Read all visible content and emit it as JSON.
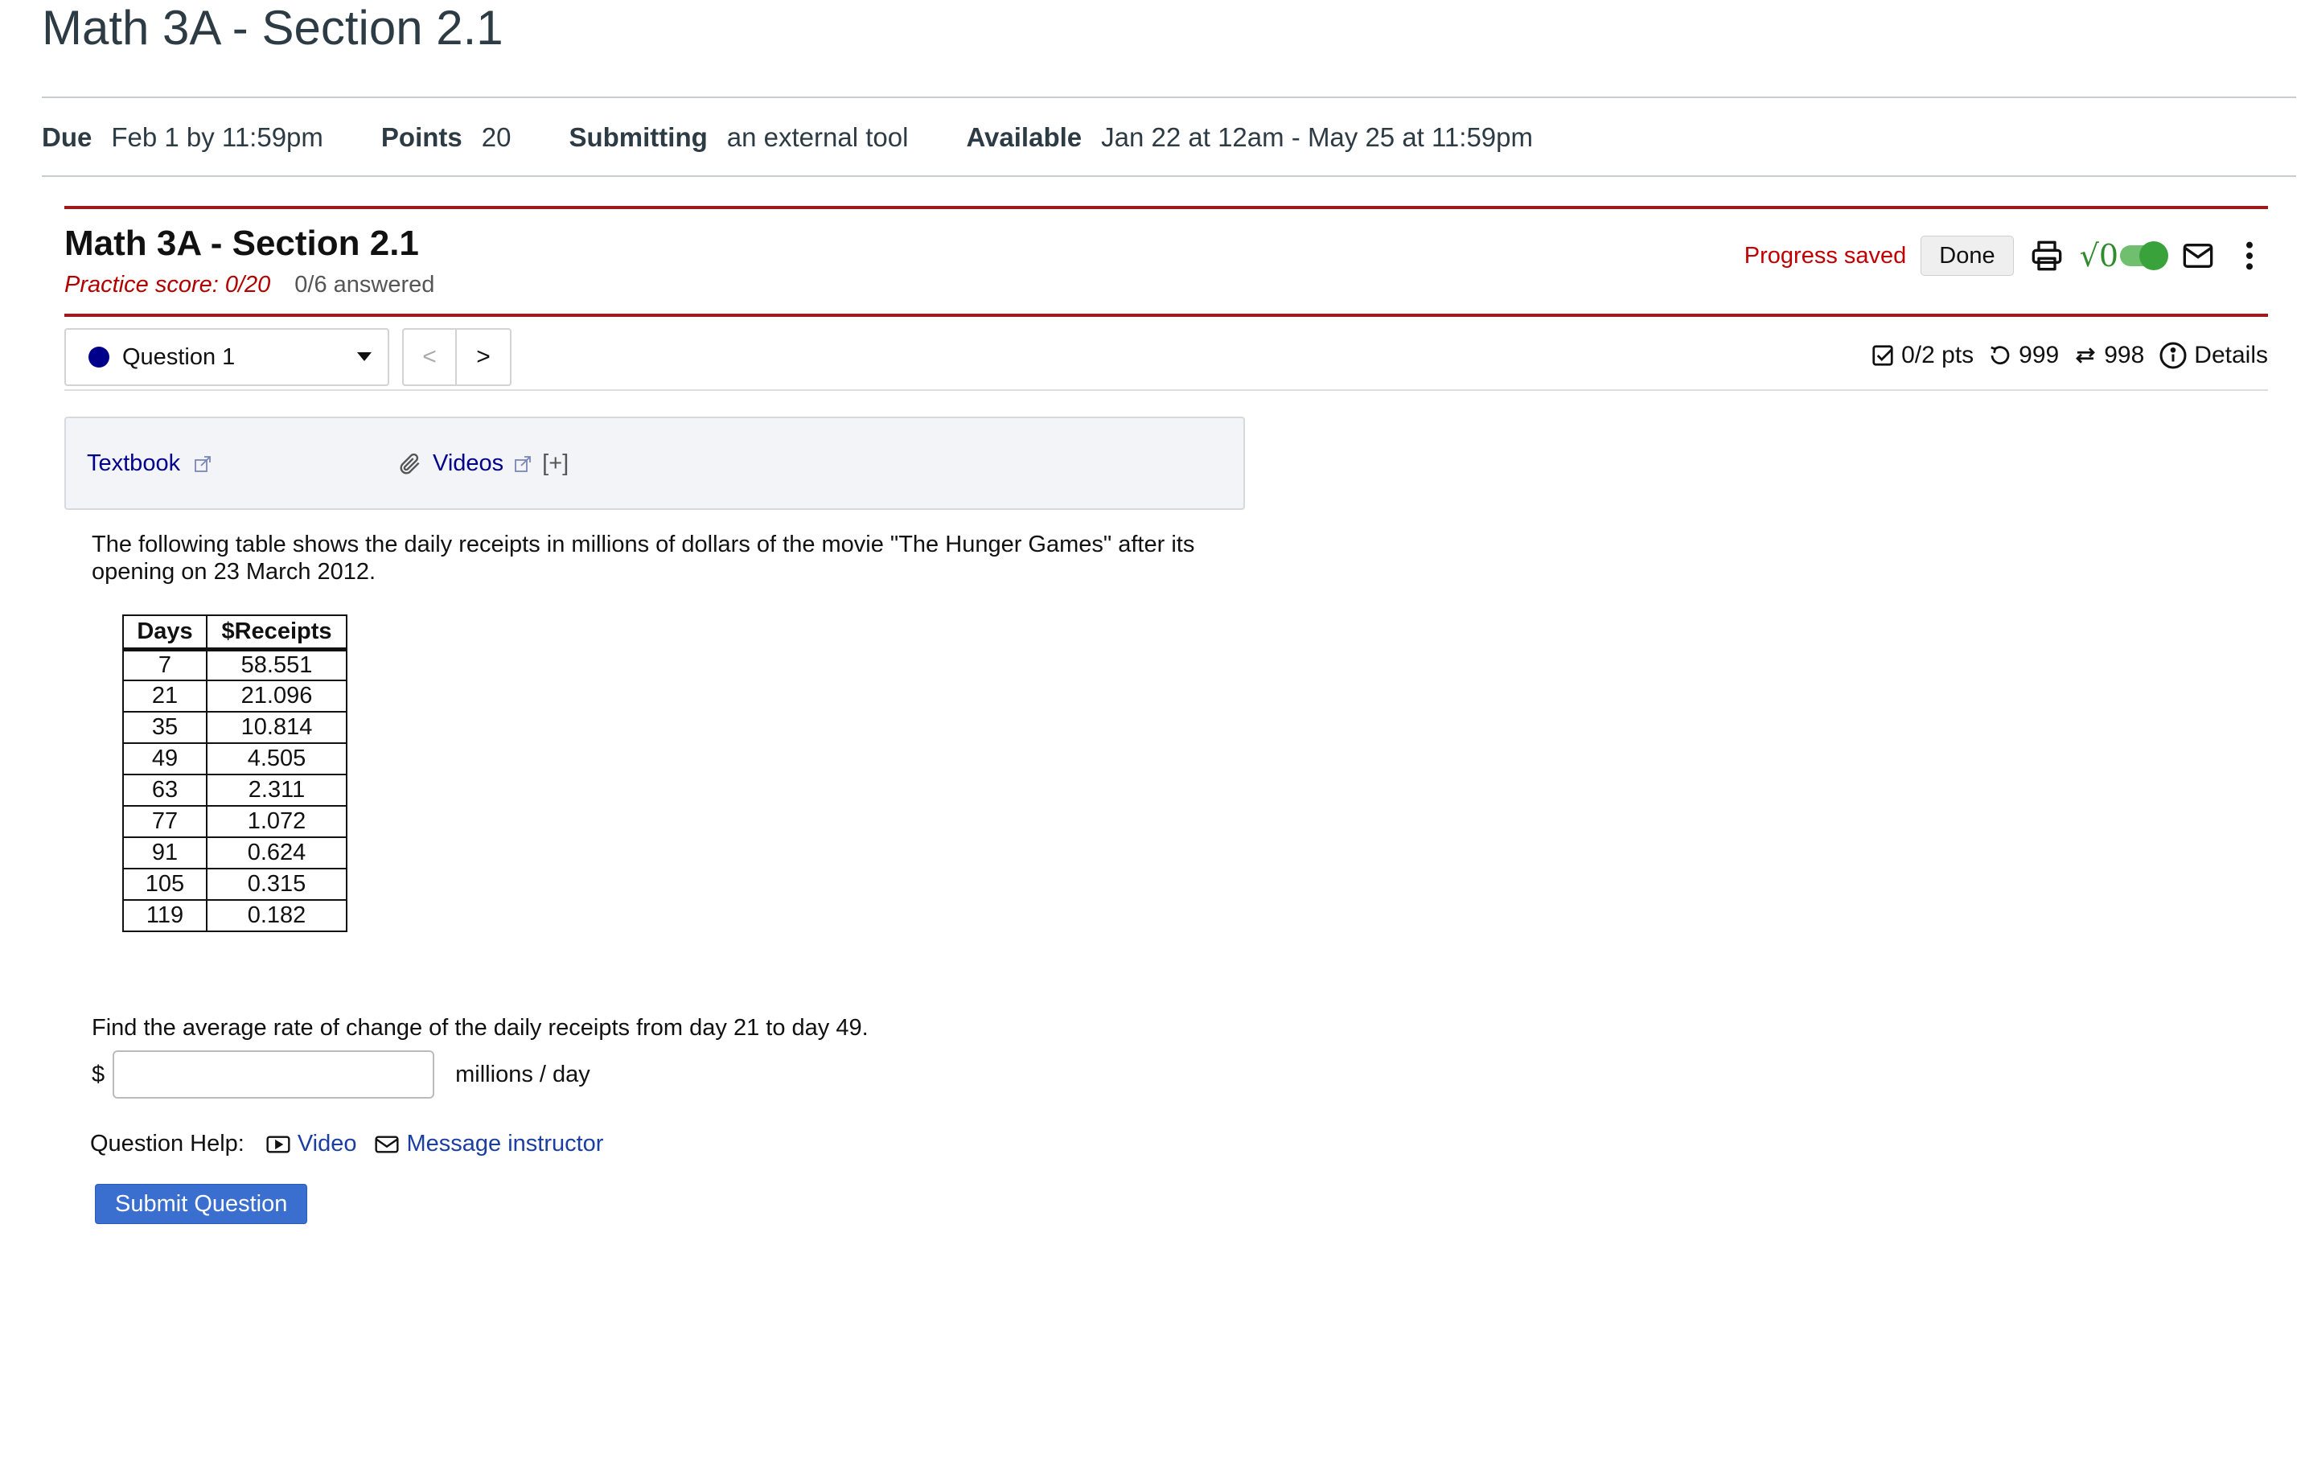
{
  "canvas": {
    "page_title": "Math 3A - Section 2.1",
    "meta": {
      "due_label": "Due",
      "due_value": "Feb 1 by 11:59pm",
      "points_label": "Points",
      "points_value": "20",
      "submitting_label": "Submitting",
      "submitting_value": "an external tool",
      "available_label": "Available",
      "available_value": "Jan 22 at 12am - May 25 at 11:59pm"
    }
  },
  "assessment": {
    "title": "Math 3A - Section 2.1",
    "practice_score": "Practice score: 0/20",
    "answered": "0/6 answered",
    "progress_saved": "Progress saved",
    "done_label": "Done",
    "mathquill_symbol": "√0"
  },
  "question_nav": {
    "selected_question": "Question 1",
    "prev_symbol": "<",
    "next_symbol": ">",
    "points": "0/2 pts",
    "retries": "999",
    "regens": "998",
    "details_label": "Details"
  },
  "help_box": {
    "textbook_label": "Textbook",
    "videos_label": "Videos",
    "expand_label": "[+]"
  },
  "question": {
    "prompt": "The following table shows the daily receipts in millions of dollars of the movie \"The Hunger Games\" after its opening on 23 March 2012.",
    "table": {
      "headers": [
        "Days",
        "$Receipts"
      ],
      "rows": [
        [
          "7",
          "58.551"
        ],
        [
          "21",
          "21.096"
        ],
        [
          "35",
          "10.814"
        ],
        [
          "49",
          "4.505"
        ],
        [
          "63",
          "2.311"
        ],
        [
          "77",
          "1.072"
        ],
        [
          "91",
          "0.624"
        ],
        [
          "105",
          "0.315"
        ],
        [
          "119",
          "0.182"
        ]
      ]
    },
    "find_text": "Find the average rate of change of the daily receipts from day 21 to day 49.",
    "answer_prefix": "$",
    "answer_value": "",
    "answer_units": "millions / day",
    "help_label": "Question Help:",
    "help_video": "Video",
    "help_message": "Message instructor",
    "submit_label": "Submit Question"
  },
  "colors": {
    "accent_red": "#9e1b1b",
    "progress_red": "#c00000",
    "link_blue": "#00008b",
    "submit_blue": "#3a6fd0",
    "toggle_green": "#3aa23a"
  },
  "icons": [
    "external-link-icon",
    "paperclip-icon",
    "printer-icon",
    "mail-icon",
    "kebab-menu-icon",
    "checkbox-icon",
    "retry-icon",
    "regen-icon",
    "info-icon",
    "video-icon"
  ]
}
